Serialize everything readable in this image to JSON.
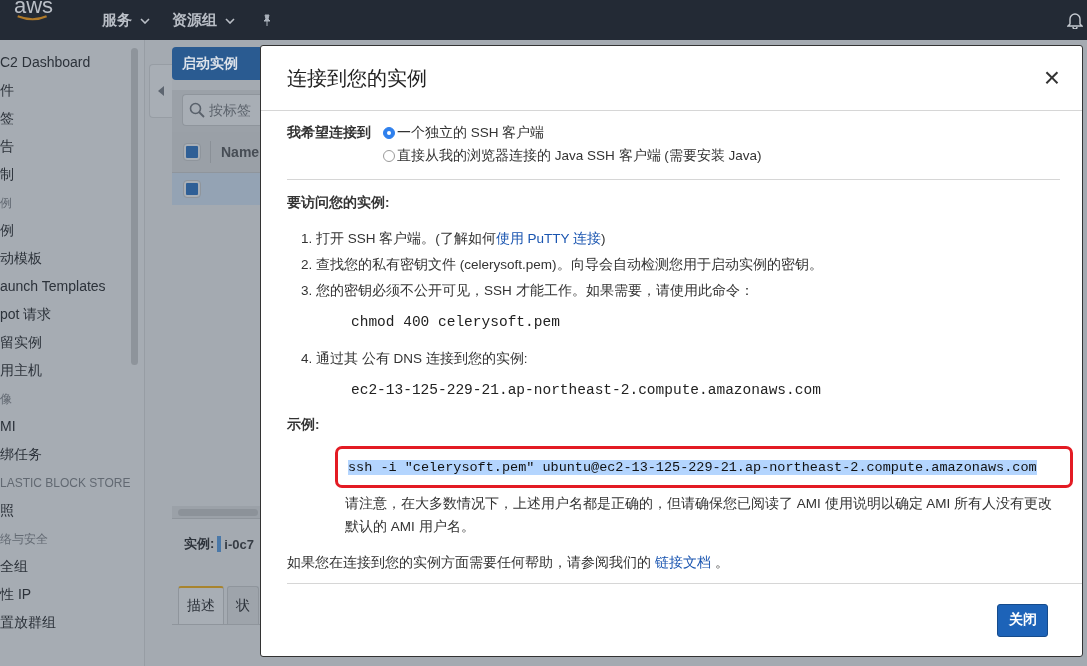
{
  "top_nav": {
    "logo": "aws",
    "menus": [
      {
        "label": "服务"
      },
      {
        "label": "资源组"
      }
    ]
  },
  "sidebar": {
    "items": [
      {
        "kind": "item",
        "label": "C2 Dashboard"
      },
      {
        "kind": "item",
        "label": "件"
      },
      {
        "kind": "item",
        "label": "签"
      },
      {
        "kind": "item",
        "label": "告"
      },
      {
        "kind": "item",
        "label": "制"
      },
      {
        "kind": "header",
        "label": "例"
      },
      {
        "kind": "item",
        "label": "例"
      },
      {
        "kind": "item",
        "label": "动模板"
      },
      {
        "kind": "item",
        "label": "aunch Templates"
      },
      {
        "kind": "item",
        "label": "pot 请求"
      },
      {
        "kind": "item",
        "label": "留实例"
      },
      {
        "kind": "item",
        "label": "用主机"
      },
      {
        "kind": "header",
        "label": "像"
      },
      {
        "kind": "item",
        "label": "MI"
      },
      {
        "kind": "item",
        "label": "绑任务"
      },
      {
        "kind": "header",
        "label": "LASTIC BLOCK STORE"
      },
      {
        "kind": "item",
        "label": "照"
      },
      {
        "kind": "header",
        "label": "络与安全"
      },
      {
        "kind": "item",
        "label": "全组"
      },
      {
        "kind": "item",
        "label": "性 IP"
      },
      {
        "kind": "item",
        "label": "置放群组"
      }
    ]
  },
  "launch_button": "启动实例",
  "search": {
    "placeholder": "按标签"
  },
  "table": {
    "header_checked": true,
    "columns": [
      "Name"
    ],
    "rows": [
      {
        "checked": true
      }
    ]
  },
  "detail": {
    "label": "实例:",
    "value": "i-0c7"
  },
  "detail_tabs": [
    {
      "label": "描述",
      "selected": true
    },
    {
      "label": "状",
      "selected": false
    }
  ],
  "modal": {
    "title": "连接到您的实例",
    "close_icon": "×",
    "connect_label": "我希望连接到",
    "options": [
      {
        "label": "一个独立的 SSH 客户端",
        "selected": true
      },
      {
        "label": "直接从我的浏览器连接的 Java SSH 客户端 (需要安装 Java)",
        "selected": false
      }
    ],
    "access_heading": "要访问您的实例:",
    "steps": [
      {
        "number": "1.",
        "text": "打开 SSH 客户端。(了解如何",
        "link": "使用 PuTTY 连接",
        "after": ")"
      },
      {
        "number": "2.",
        "text": "查找您的私有密钥文件 (celerysoft.pem)。向导会自动检测您用于启动实例的密钥。"
      },
      {
        "number": "3.",
        "text": "您的密钥必须不公开可见，SSH 才能工作。如果需要，请使用此命令：",
        "code": "chmod 400 celerysoft.pem"
      },
      {
        "number": "4.",
        "text": "通过其 公有 DNS 连接到您的实例:",
        "code": "ec2-13-125-229-21.ap-northeast-2.compute.amazonaws.com"
      }
    ],
    "example_label": "示例:",
    "example_command": "ssh -i \"celerysoft.pem\" ubuntu@ec2-13-125-229-21.ap-northeast-2.compute.amazonaws.com",
    "note": "请注意，在大多数情况下，上述用户名都是正确的，但请确保您已阅读了 AMI 使用说明以确定 AMI 所有人没有更改默认的 AMI 用户名。",
    "help_text": "如果您在连接到您的实例方面需要任何帮助，请参阅我们的",
    "help_link": "链接文档",
    "help_after": "。",
    "close_button": "关闭"
  }
}
